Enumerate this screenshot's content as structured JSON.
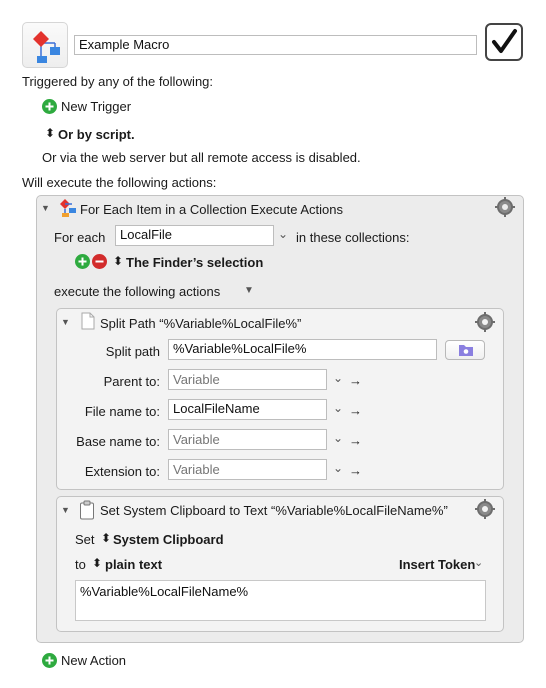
{
  "header": {
    "macro_name": "Example Macro",
    "enabled_check": "✓"
  },
  "triggers": {
    "heading": "Triggered by any of the following:",
    "new_trigger": "New Trigger",
    "or_by_script": "Or by script.",
    "web_server_note": "Or via the web server but all remote access is disabled."
  },
  "actions": {
    "heading": "Will execute the following actions:",
    "new_action": "New Action"
  },
  "for_each": {
    "title": "For Each Item in a Collection Execute Actions",
    "for_each_label": "For each",
    "variable": "LocalFile",
    "in_collections": "in these collections:",
    "collection": "The Finder’s selection",
    "execute_label": "execute the following actions"
  },
  "split_path": {
    "title": "Split Path “%Variable%LocalFile%”",
    "split_path_label": "Split path",
    "split_path_value": "%Variable%LocalFile%",
    "rows": [
      {
        "label": "Parent to:",
        "value": "",
        "placeholder": "Variable"
      },
      {
        "label": "File name to:",
        "value": "LocalFileName",
        "placeholder": "Variable"
      },
      {
        "label": "Base name to:",
        "value": "",
        "placeholder": "Variable"
      },
      {
        "label": "Extension to:",
        "value": "",
        "placeholder": "Variable"
      }
    ]
  },
  "clipboard": {
    "title": "Set System Clipboard to Text “%Variable%LocalFileName%”",
    "set_label": "Set",
    "clipboard_name": "System Clipboard",
    "to_label": "to",
    "format": "plain text",
    "insert_token": "Insert Token",
    "text_value": "%Variable%LocalFileName%"
  },
  "glyphs": {
    "disclosure": "▼",
    "gear": "⚙",
    "updown": "⬍",
    "chev": "⌄",
    "arrow": "→",
    "plus": "+",
    "minus": "−"
  },
  "colors": {
    "add_green": "#2eaa3f",
    "remove_red": "#d22b2b",
    "folder_button_purple": "#8a7fe0"
  }
}
